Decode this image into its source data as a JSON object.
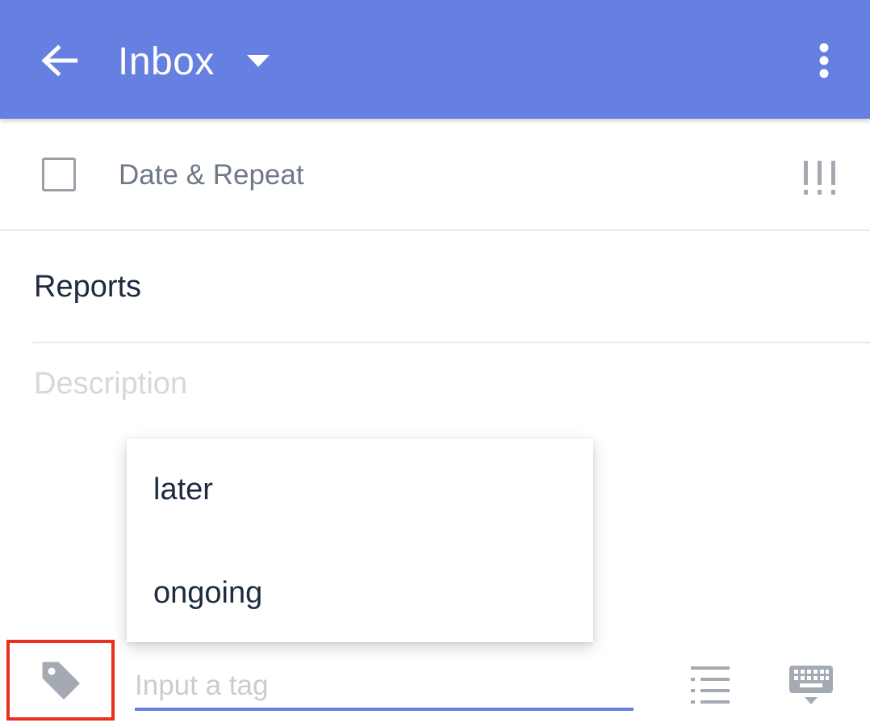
{
  "app_bar": {
    "title": "Inbox",
    "back_icon": "arrow-left-icon",
    "dropdown_icon": "caret-down-icon",
    "more_icon": "more-vertical-icon",
    "background": "#6580e0"
  },
  "task": {
    "date_repeat_label": "Date & Repeat",
    "priority_label": "!!!",
    "title": "Reports",
    "description_placeholder": "Description"
  },
  "tag_suggestions": [
    "later",
    "ongoing"
  ],
  "tag_bar": {
    "tag_icon": "tag-icon",
    "input_placeholder": "Input a tag",
    "input_value": "",
    "list_icon": "checklist-icon",
    "keyboard_icon": "keyboard-hide-icon",
    "highlight_color": "#e8301e",
    "accent": "#6580e0"
  }
}
